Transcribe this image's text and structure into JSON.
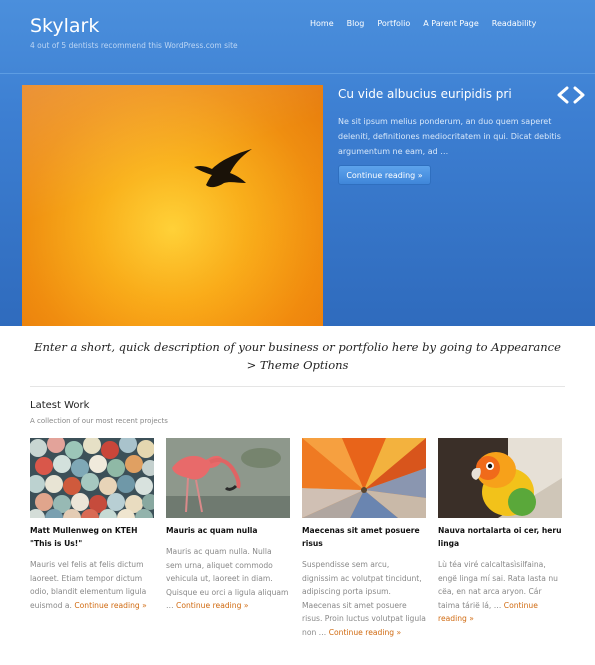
{
  "site": {
    "title": "Skylark",
    "description": "4 out of 5 dentists recommend this WordPress.com site"
  },
  "nav": {
    "items": [
      "Home",
      "Blog",
      "Portfolio",
      "A Parent Page",
      "Readability"
    ]
  },
  "featured": {
    "title": "Cu vide albucius euripidis pri",
    "excerpt": "Ne sit ipsum melius ponderum, an duo quem saperet deleniti, definitiones mediocritatem in qui. Dicat debitis argumentum ne eam, ad …",
    "button_label": "Continue reading »",
    "prev_icon": "chevron-left-icon",
    "next_icon": "chevron-right-icon"
  },
  "tagline": "Enter a short, quick description of your business or portfolio here by going to Appearance > Theme Options",
  "latest_work": {
    "title": "Latest Work",
    "subtitle": "A collection of our most recent projects",
    "items": [
      {
        "title": "Matt Mullenweg on KTEH \"This is Us!\"",
        "excerpt": "Mauris vel felis at felis dictum laoreet. Etiam tempor dictum odio, blandit elementum ligula euismod a.",
        "more": "Continue reading »"
      },
      {
        "title": "Mauris ac quam nulla",
        "excerpt": "Mauris ac quam nulla. Nulla sem urna, aliquet commodo vehicula ut, laoreet in diam. Quisque eu orci a ligula aliquam …",
        "more": "Continue reading »"
      },
      {
        "title": "Maecenas sit amet posuere risus",
        "excerpt": "Suspendisse sem arcu, dignissim ac volutpat tincidunt, adipiscing porta ipsum. Maecenas sit amet posuere risus. Proin luctus volutpat ligula non …",
        "more": "Continue reading »"
      },
      {
        "title": "Nauva nortalarta oi cer, heru linga",
        "excerpt": "Lù téa viré calcaltasìsilfaina, engë linga mí sai. Rata lasta nu cëa, en nat arca aryon. Cár taima tárië lá, …",
        "more": "Continue reading »"
      }
    ]
  },
  "colors": {
    "hero_blue": "#3d7fd2",
    "link_orange": "#d06a10"
  }
}
